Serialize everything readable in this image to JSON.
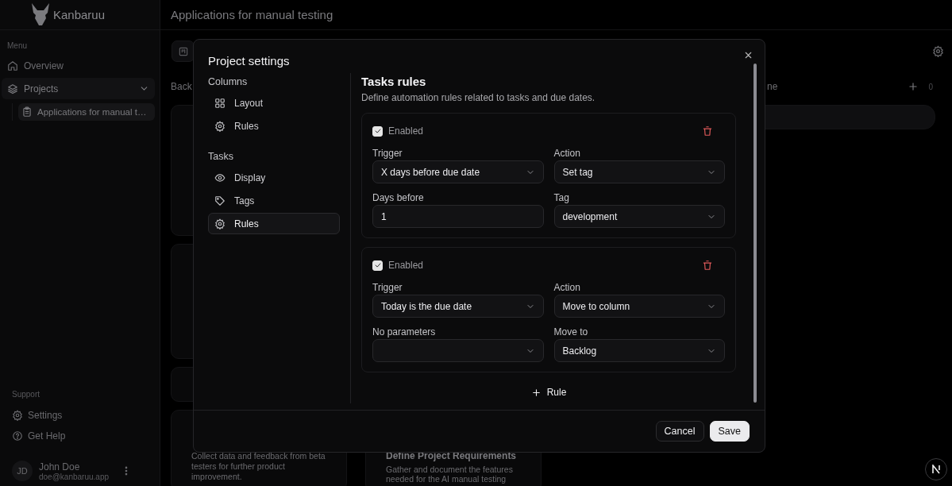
{
  "app": {
    "name": "Kanbaruu"
  },
  "sidebar": {
    "menu_label": "Menu",
    "items": [
      {
        "label": "Overview",
        "selected": false
      },
      {
        "label": "Projects",
        "selected": true,
        "expanded": true,
        "children": [
          {
            "label": "Applications for manual t…",
            "selected": true
          }
        ]
      }
    ],
    "support_label": "Support",
    "support_items": [
      {
        "label": "Settings"
      },
      {
        "label": "Get Help"
      }
    ],
    "user": {
      "initials": "JD",
      "name": "John Doe",
      "email": "doe@kanbaruu.app"
    }
  },
  "page": {
    "title": "Applications for manual testing"
  },
  "board": {
    "columns": [
      {
        "title": "Back",
        "cards": [
          {
            "kind": "covered"
          },
          {
            "kind": "covered"
          },
          {
            "kind": "covered"
          },
          {
            "kind": "task",
            "description": "Collect data and feedback from beta testers for further product improvement."
          }
        ]
      },
      {
        "cards": [
          {
            "kind": "task",
            "title": "Define Project Requirements",
            "description": "Gather and document the features needed for the AI manual testing"
          }
        ]
      },
      {
        "title": "ne",
        "count": "0",
        "cards": [
          {
            "kind": "covered"
          }
        ]
      }
    ]
  },
  "dialog": {
    "title": "Project settings",
    "nav": [
      {
        "heading": "Columns",
        "items": [
          {
            "label": "Layout",
            "selected": false
          },
          {
            "label": "Rules",
            "selected": false
          }
        ]
      },
      {
        "heading": "Tasks",
        "items": [
          {
            "label": "Display",
            "selected": false
          },
          {
            "label": "Tags",
            "selected": false
          },
          {
            "label": "Rules",
            "selected": true
          }
        ]
      }
    ],
    "section": {
      "title": "Tasks rules",
      "description": "Define automation rules related to tasks and due dates."
    },
    "rules": [
      {
        "enabled_label": "Enabled",
        "enabled": true,
        "fields": [
          {
            "label": "Trigger",
            "kind": "select",
            "value": "X days before due date"
          },
          {
            "label": "Action",
            "kind": "select",
            "value": "Set tag"
          },
          {
            "label": "Days before",
            "kind": "input",
            "value": "1"
          },
          {
            "label": "Tag",
            "kind": "select",
            "value": "development"
          }
        ]
      },
      {
        "enabled_label": "Enabled",
        "enabled": true,
        "fields": [
          {
            "label": "Trigger",
            "kind": "select",
            "value": "Today is the due date"
          },
          {
            "label": "Action",
            "kind": "select",
            "value": "Move to column"
          },
          {
            "label": "No parameters",
            "kind": "select"
          },
          {
            "label": "Move to",
            "kind": "select",
            "value": "Backlog"
          }
        ]
      }
    ],
    "add_rule": "Rule",
    "buttons": [
      {
        "label": "Cancel",
        "kind": "secondary"
      },
      {
        "label": "Save",
        "kind": "primary"
      }
    ]
  }
}
